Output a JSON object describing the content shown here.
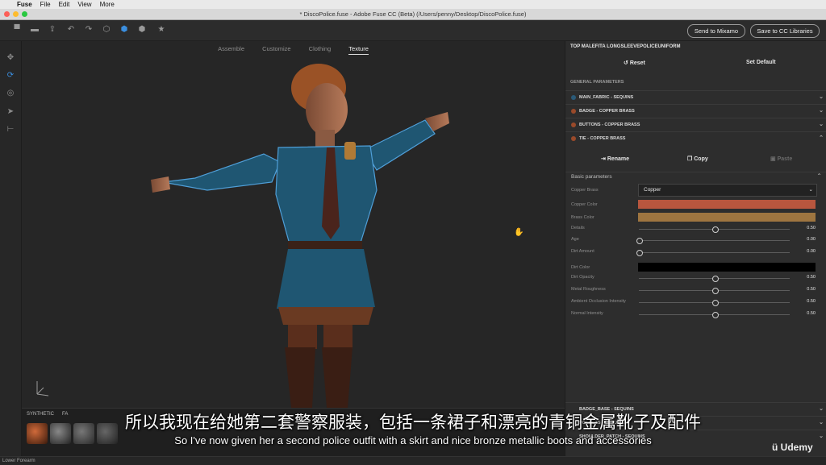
{
  "menubar": {
    "apple": "",
    "app": "Fuse",
    "items": [
      "File",
      "Edit",
      "View",
      "More"
    ]
  },
  "window": {
    "title": "* DiscoPolice.fuse - Adobe Fuse CC (Beta) (/Users/penny/Desktop/DiscoPolice.fuse)"
  },
  "toolbar": {
    "send_mixamo": "Send to Mixamo",
    "save_cc": "Save to CC Libraries"
  },
  "tabs": [
    "Assemble",
    "Customize",
    "Clothing",
    "Texture"
  ],
  "active_tab": "Texture",
  "tray": {
    "labels": [
      "SYNTHETIC",
      "FA"
    ]
  },
  "panel": {
    "title": "TOP MALEFITA LONGSLEEVEPOLICEUNIFORM",
    "reset": "Reset",
    "set_default": "Set Default",
    "general": "GENERAL PARAMETERS",
    "sections": [
      {
        "label": "MAIN_FABRIC - SEQUINS",
        "color": "#2a5a78"
      },
      {
        "label": "BADGE - COPPER BRASS",
        "color": "#9a4a2a"
      },
      {
        "label": "BUTTONS - COPPER BRASS",
        "color": "#9a4a2a"
      },
      {
        "label": "TIE - COPPER BRASS",
        "color": "#9a4a2a"
      }
    ],
    "rename": "Rename",
    "copy": "Copy",
    "paste": "Paste",
    "basic": "Basic parameters",
    "params": {
      "copper_brass_label": "Copper Brass",
      "copper_brass_value": "Copper",
      "copper_color_label": "Copper Color",
      "copper_color": "#b8563e",
      "brass_color_label": "Brass Color",
      "brass_color": "#9e7540",
      "dirt_color_label": "Dirt Color",
      "dirt_color": "#000000",
      "sliders": [
        {
          "label": "Details",
          "value": "0.50",
          "frac": 0.5
        },
        {
          "label": "Age",
          "value": "0.00",
          "frac": 0.0
        },
        {
          "label": "Dirt Amount",
          "value": "0.00",
          "frac": 0.0
        },
        {
          "label": "Dirt Opacity",
          "value": "0.50",
          "frac": 0.5
        },
        {
          "label": "Metal Roughness",
          "value": "0.50",
          "frac": 0.5
        },
        {
          "label": "Ambient Occlusion Intensity",
          "value": "0.50",
          "frac": 0.5
        },
        {
          "label": "Normal Intensity",
          "value": "0.50",
          "frac": 0.5
        }
      ]
    },
    "bottom_sections": [
      "BADGE_BASE - SEQUINS",
      "POCKETS - SEQUINS",
      "SHOULDER_PATCH - SEQUINS"
    ]
  },
  "status": "Lower Forearm",
  "subtitle_cn": "所以我现在给她第二套警察服装，包括一条裙子和漂亮的青铜金属靴子及配件",
  "subtitle_en": "So I've now given her a second police outfit with a skirt and nice bronze metallic boots and accessories",
  "watermark": "Udemy"
}
